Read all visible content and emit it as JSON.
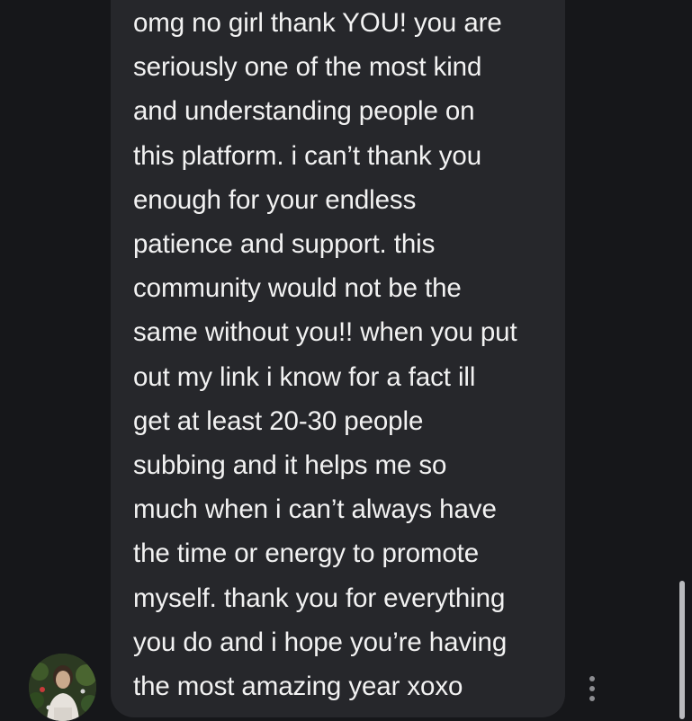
{
  "message": {
    "lines": [
      "omg no girl thank YOU! you are",
      "seriously one of the most kind",
      "and understanding people on",
      "this platform. i can’t thank you",
      "enough for your endless",
      "patience and support. this",
      "community would not be the",
      "same without you!! when you put",
      "out my link i know for a fact ill",
      "get at least 20-30 people",
      "subbing and it helps me so",
      "much when i can’t always have",
      "the time or energy to promote",
      "myself. thank you for everything",
      "you do and i hope you’re having",
      "the most amazing year xoxo"
    ]
  },
  "avatar": {
    "alt": "sender avatar"
  },
  "icons": {
    "more": "more-vertical-icon"
  },
  "colors": {
    "background": "#16171a",
    "bubble": "#26272b",
    "text": "#f2f2f2",
    "icon": "#8c8d91",
    "scrollbar": "#b9babd"
  }
}
